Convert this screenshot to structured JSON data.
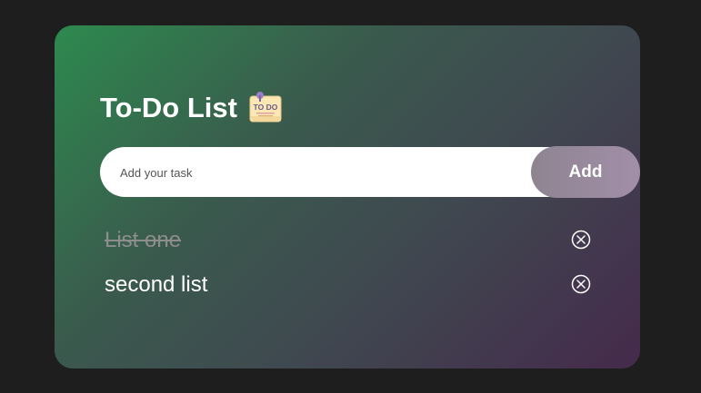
{
  "app": {
    "title": "To-Do List",
    "icon": "todo-note-icon",
    "icon_text": "TO DO"
  },
  "input": {
    "placeholder": "Add your task",
    "value": "",
    "add_label": "Add"
  },
  "tasks": [
    {
      "label": "List one",
      "completed": true
    },
    {
      "label": "second list",
      "completed": false
    }
  ],
  "colors": {
    "page_background": "#1e1e1e",
    "card_gradient_start": "#2d8a4e",
    "card_gradient_end": "#452a4c",
    "add_button_start": "#8e8591",
    "add_button_end": "#a28ea8",
    "completed_text": "#8d8d8d"
  }
}
